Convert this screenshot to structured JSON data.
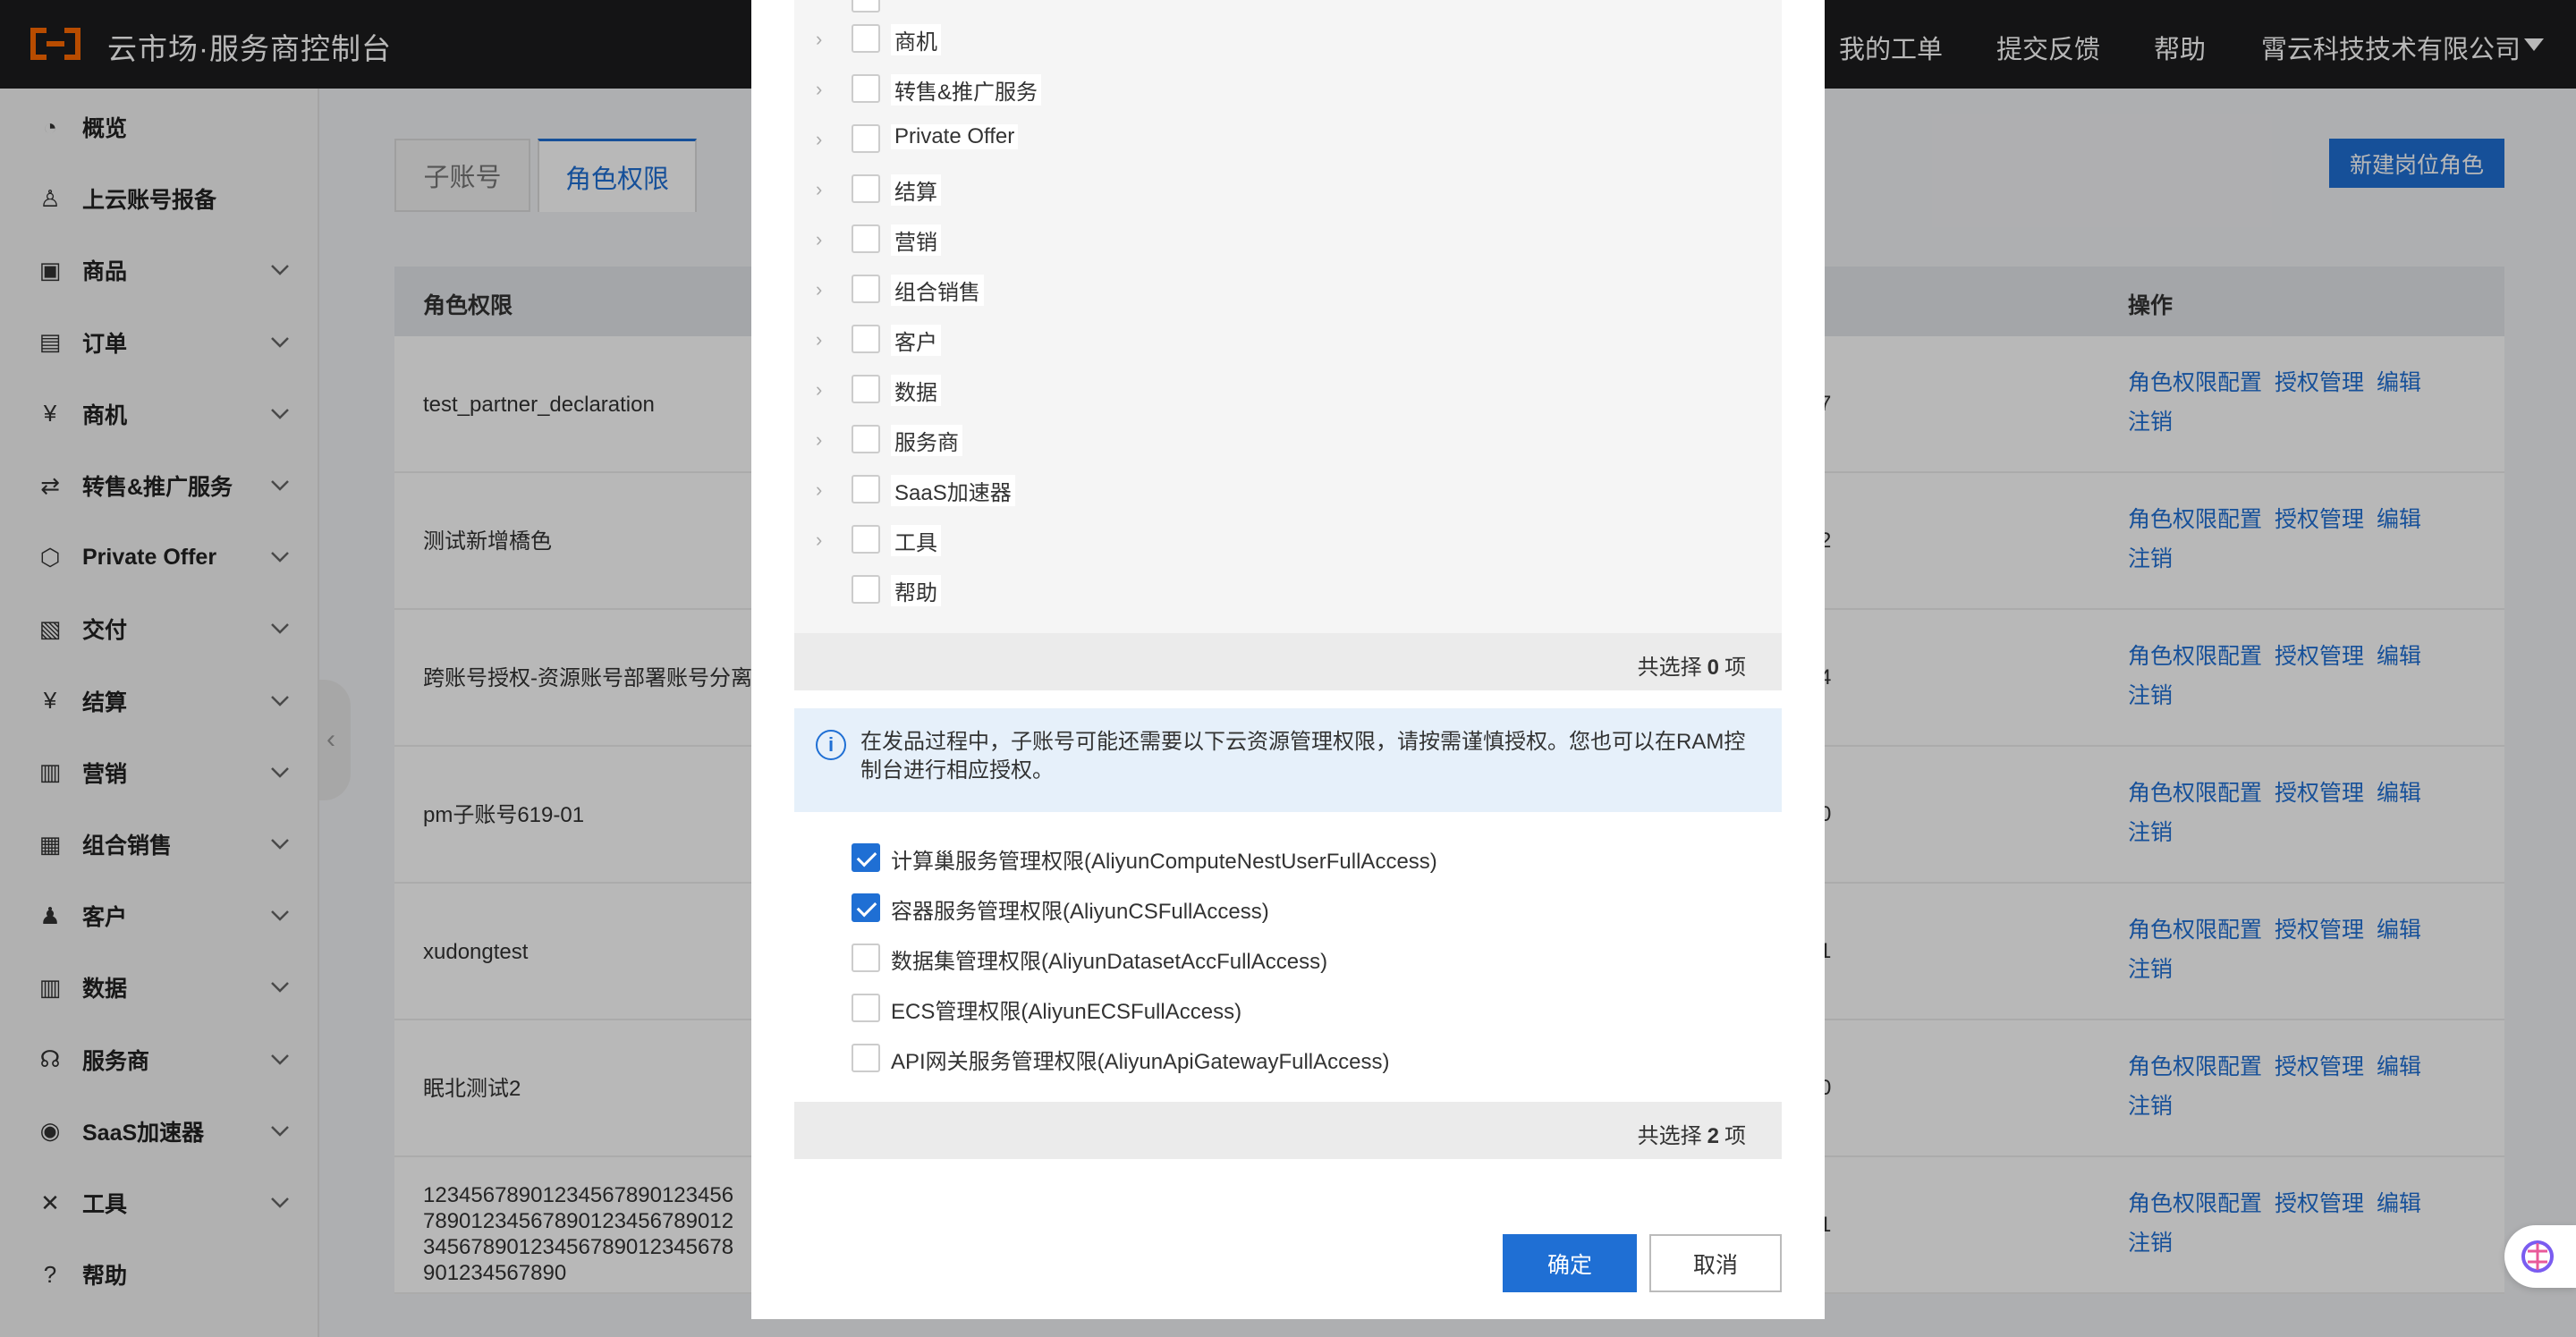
{
  "app": {
    "title": "云市场·服务商控制台"
  },
  "topnav": {
    "tickets": "我的工单",
    "feedback": "提交反馈",
    "help": "帮助",
    "company": "霄云科技技术有限公司"
  },
  "sidebar": {
    "items": [
      {
        "label": "概览",
        "icon": "dashboard-icon",
        "expandable": false
      },
      {
        "label": "上云账号报备",
        "icon": "user-icon",
        "expandable": false
      },
      {
        "label": "商品",
        "icon": "shop-icon",
        "expandable": true
      },
      {
        "label": "订单",
        "icon": "order-icon",
        "expandable": true
      },
      {
        "label": "商机",
        "icon": "opportunity-icon",
        "expandable": true
      },
      {
        "label": "转售&推广服务",
        "icon": "transfer-icon",
        "expandable": true
      },
      {
        "label": "Private Offer",
        "icon": "cube-icon",
        "expandable": true
      },
      {
        "label": "交付",
        "icon": "delivery-icon",
        "expandable": true
      },
      {
        "label": "结算",
        "icon": "yen-icon",
        "expandable": true
      },
      {
        "label": "营销",
        "icon": "marketing-icon",
        "expandable": true
      },
      {
        "label": "组合销售",
        "icon": "bundle-icon",
        "expandable": true
      },
      {
        "label": "客户",
        "icon": "customers-icon",
        "expandable": true
      },
      {
        "label": "数据",
        "icon": "bar-chart-icon",
        "expandable": true
      },
      {
        "label": "服务商",
        "icon": "headset-icon",
        "expandable": true
      },
      {
        "label": "SaaS加速器",
        "icon": "rocket-icon",
        "expandable": true
      },
      {
        "label": "工具",
        "icon": "tools-icon",
        "expandable": true
      },
      {
        "label": "帮助",
        "icon": "help-icon",
        "expandable": false
      }
    ]
  },
  "tabs": {
    "sub_account": "子账号",
    "role_permission": "角色权限"
  },
  "new_role_button": "新建岗位角色",
  "table": {
    "headers": {
      "role": "角色权限",
      "ops": "操作"
    },
    "ops": {
      "config": "角色权限配置",
      "auth": "授权管理",
      "edit": "编辑",
      "cancel": "注销"
    },
    "rows": [
      {
        "name": "test_partner_declaration",
        "mid": "7"
      },
      {
        "name": "测试新增橋色",
        "mid": "2"
      },
      {
        "name": "跨账号授权-资源账号部署账号分离",
        "mid": "4"
      },
      {
        "name": "pm子账号619-01",
        "mid": "0"
      },
      {
        "name": "xudongtest",
        "mid": "1"
      },
      {
        "name": "眠北测试2",
        "mid": "0"
      },
      {
        "name": "123456789012345678901234567890123456789012345678901234567890123456789012345678901234567890",
        "mid": "1"
      }
    ]
  },
  "modal": {
    "tree_items": [
      {
        "label": "商机",
        "arrow": true
      },
      {
        "label": "转售&推广服务",
        "arrow": true
      },
      {
        "label": "Private Offer",
        "arrow": true
      },
      {
        "label": "结算",
        "arrow": true
      },
      {
        "label": "营销",
        "arrow": true
      },
      {
        "label": "组合销售",
        "arrow": true
      },
      {
        "label": "客户",
        "arrow": true
      },
      {
        "label": "数据",
        "arrow": true
      },
      {
        "label": "服务商",
        "arrow": true
      },
      {
        "label": "SaaS加速器",
        "arrow": true
      },
      {
        "label": "工具",
        "arrow": true
      },
      {
        "label": "帮助",
        "arrow": false
      }
    ],
    "count1": {
      "prefix": "共选择",
      "value": "0",
      "suffix": "项"
    },
    "info": "在发品过程中，子账号可能还需要以下云资源管理权限，请按需谨慎授权。您也可以在RAM控制台进行相应授权。",
    "permissions": [
      {
        "label": "计算巢服务管理权限(AliyunComputeNestUserFullAccess)",
        "checked": true
      },
      {
        "label": "容器服务管理权限(AliyunCSFullAccess)",
        "checked": true
      },
      {
        "label": "数据集管理权限(AliyunDatasetAccFullAccess)",
        "checked": false
      },
      {
        "label": "ECS管理权限(AliyunECSFullAccess)",
        "checked": false
      },
      {
        "label": "API网关服务管理权限(AliyunApiGatewayFullAccess)",
        "checked": false
      }
    ],
    "count2": {
      "prefix": "共选择",
      "value": "2",
      "suffix": "项"
    },
    "ok": "确定",
    "cancel": "取消"
  },
  "colors": {
    "accent": "#1f6fd4",
    "brand_orange": "#ff6a00",
    "topbar": "#1c1c1e"
  }
}
